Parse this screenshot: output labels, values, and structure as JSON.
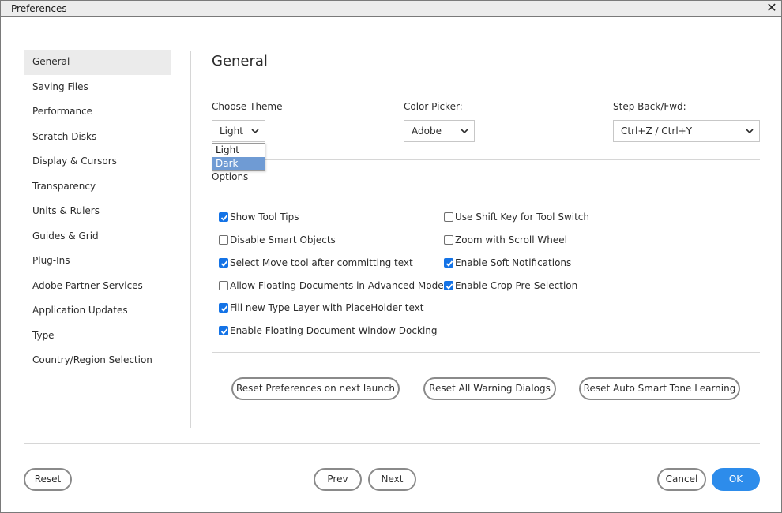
{
  "window": {
    "title": "Preferences",
    "close_icon": "close-icon"
  },
  "sidebar": {
    "items": [
      {
        "label": "General",
        "active": true
      },
      {
        "label": "Saving Files"
      },
      {
        "label": "Performance"
      },
      {
        "label": "Scratch Disks"
      },
      {
        "label": "Display & Cursors"
      },
      {
        "label": "Transparency"
      },
      {
        "label": "Units & Rulers"
      },
      {
        "label": "Guides & Grid"
      },
      {
        "label": "Plug-Ins"
      },
      {
        "label": "Adobe Partner Services"
      },
      {
        "label": "Application Updates"
      },
      {
        "label": "Type"
      },
      {
        "label": "Country/Region Selection"
      }
    ]
  },
  "main": {
    "title": "General",
    "theme": {
      "label": "Choose Theme",
      "value": "Light",
      "options": [
        "Light",
        "Dark"
      ],
      "highlighted": "Dark"
    },
    "color_picker": {
      "label": "Color Picker:",
      "value": "Adobe"
    },
    "step_back": {
      "label": "Step Back/Fwd:",
      "value": "Ctrl+Z / Ctrl+Y"
    },
    "options_label": "Options",
    "options_left": [
      {
        "label": "Show Tool Tips",
        "checked": true
      },
      {
        "label": "Disable Smart Objects",
        "checked": false
      },
      {
        "label": "Select Move tool after committing text",
        "checked": true
      },
      {
        "label": "Allow Floating Documents in Advanced Mode",
        "checked": false
      },
      {
        "label": "Fill new Type Layer with PlaceHolder text",
        "checked": true
      },
      {
        "label": "Enable Floating Document Window Docking",
        "checked": true
      }
    ],
    "options_right": [
      {
        "label": "Use Shift Key for Tool Switch",
        "checked": false
      },
      {
        "label": "Zoom with Scroll Wheel",
        "checked": false
      },
      {
        "label": "Enable Soft Notifications",
        "checked": true
      },
      {
        "label": "Enable Crop Pre-Selection",
        "checked": true
      }
    ],
    "reset_buttons": {
      "reset_prefs": "Reset Preferences on next launch",
      "reset_warnings": "Reset All Warning Dialogs",
      "reset_tone": "Reset Auto Smart Tone Learning"
    }
  },
  "footer": {
    "reset": "Reset",
    "prev": "Prev",
    "next": "Next",
    "cancel": "Cancel",
    "ok": "OK"
  },
  "colors": {
    "accent": "#2d8ceb",
    "checkbox_on": "#1473e6",
    "dropdown_highlight": "#6f9bd4"
  }
}
